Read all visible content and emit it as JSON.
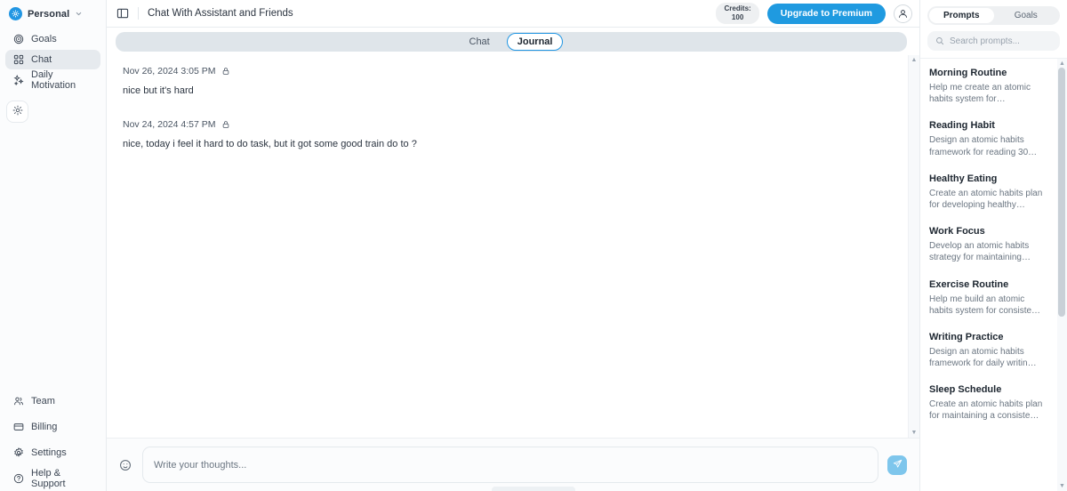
{
  "sidebar": {
    "workspace": {
      "name": "Personal",
      "icon": "workspace-logo-icon",
      "chevron": "chevron-down-icon"
    },
    "items": [
      {
        "label": "Goals",
        "icon": "target-icon",
        "active": false
      },
      {
        "label": "Chat",
        "icon": "grid-icon",
        "active": true
      },
      {
        "label": "Daily Motivation",
        "icon": "sparkle-icon",
        "active": false
      }
    ],
    "theme_toggle": {
      "icon": "sun-icon",
      "label": ""
    },
    "bottom_items": [
      {
        "label": "Team",
        "icon": "users-icon"
      },
      {
        "label": "Billing",
        "icon": "credit-card-icon"
      },
      {
        "label": "Settings",
        "icon": "gear-icon"
      },
      {
        "label": "Help & Support",
        "icon": "question-circle-icon"
      }
    ]
  },
  "topbar": {
    "panel_toggle_icon": "sidebar-panel-icon",
    "title": "Chat With Assistant and Friends",
    "credits_label": "Credits:",
    "credits_value": "100",
    "upgrade_label": "Upgrade to Premium",
    "avatar_icon": "user-avatar-icon"
  },
  "tabs": [
    {
      "label": "Chat",
      "active": false
    },
    {
      "label": "Journal",
      "active": true
    }
  ],
  "journal": {
    "entries": [
      {
        "date": "Nov 26, 2024 3:05 PM",
        "lock_icon": "lock-icon",
        "text": "nice but it's hard"
      },
      {
        "date": "Nov 24, 2024 4:57 PM",
        "lock_icon": "lock-icon",
        "text": "nice, today i feel it hard to do task, but it got some good train do to ?"
      }
    ],
    "scroll_up_arrow": "▲",
    "scroll_down_arrow": "▼"
  },
  "composer": {
    "emoji_icon": "smiley-icon",
    "placeholder": "Write your thoughts...",
    "value": "",
    "send_icon": "send-paper-plane-icon"
  },
  "right_panel": {
    "segments": [
      {
        "label": "Prompts",
        "active": true
      },
      {
        "label": "Goals",
        "active": false
      }
    ],
    "search": {
      "icon": "search-icon",
      "placeholder": "Search prompts...",
      "value": ""
    },
    "prompts": [
      {
        "title": "Morning Routine",
        "desc": "Help me create an atomic habits system for…"
      },
      {
        "title": "Reading Habit",
        "desc": "Design an atomic habits framework for reading 30…"
      },
      {
        "title": "Healthy Eating",
        "desc": "Create an atomic habits plan for developing healthy…"
      },
      {
        "title": "Work Focus",
        "desc": "Develop an atomic habits strategy for maintaining…"
      },
      {
        "title": "Exercise Routine",
        "desc": "Help me build an atomic habits system for consiste…"
      },
      {
        "title": "Writing Practice",
        "desc": "Design an atomic habits framework for daily writin…"
      },
      {
        "title": "Sleep Schedule",
        "desc": "Create an atomic habits plan for maintaining a consiste…"
      }
    ],
    "scroll_up_arrow": "▲",
    "scroll_down_arrow": "▼"
  },
  "colors": {
    "accent": "#1f9ae0",
    "active_tab_border": "#2196e3",
    "send_button": "#7ec6ec",
    "sidebar_bg": "#fbfcfd",
    "tabstrip_bg": "#dfe5ea"
  }
}
